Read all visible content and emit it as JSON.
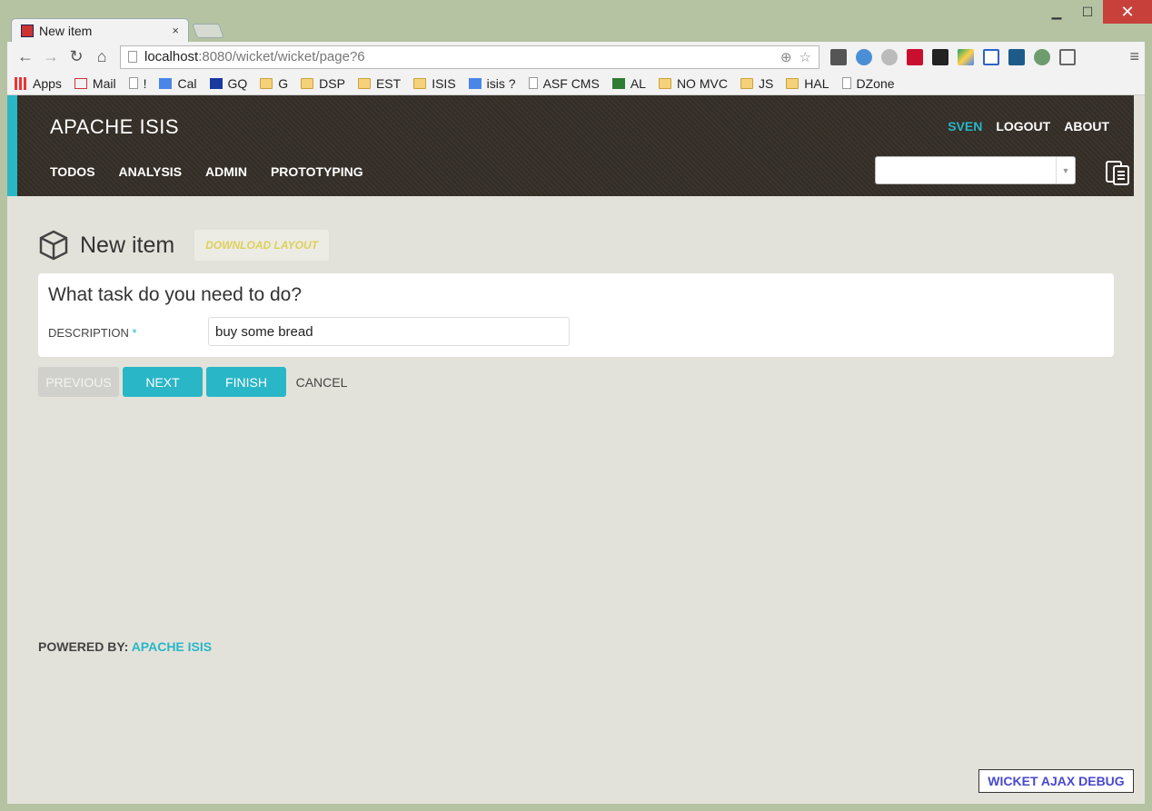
{
  "browser": {
    "tab_title": "New item",
    "tab_close": "×",
    "url_host": "localhost",
    "url_path": ":8080/wicket/wicket/page?6",
    "bookmarks": [
      "Apps",
      "Mail",
      "!",
      "Cal",
      "GQ",
      "G",
      "DSP",
      "EST",
      "ISIS",
      "isis ?",
      "ASF CMS",
      "AL",
      "NO MVC",
      "JS",
      "HAL",
      "DZone"
    ]
  },
  "app": {
    "brand": "APACHE ISIS",
    "user": "SVEN",
    "logout": "LOGOUT",
    "about": "ABOUT",
    "menu": [
      "TODOS",
      "ANALYSIS",
      "ADMIN",
      "PROTOTYPING"
    ]
  },
  "page": {
    "title": "New item",
    "download_layout": "DOWNLOAD LAYOUT",
    "panel_title": "What task do you need to do?",
    "description_label": "DESCRIPTION",
    "required_marker": "*",
    "description_value": "buy some bread"
  },
  "actions": {
    "previous": "PREVIOUS",
    "next": "NEXT",
    "finish": "FINISH",
    "cancel": "CANCEL"
  },
  "footer": {
    "powered_by": "POWERED BY:",
    "link": "APACHE ISIS"
  },
  "debug": {
    "label": "WICKET AJAX DEBUG"
  },
  "colors": {
    "accent": "#29b6c7",
    "header_bg": "#332d26",
    "page_bg": "#e3e2da"
  }
}
